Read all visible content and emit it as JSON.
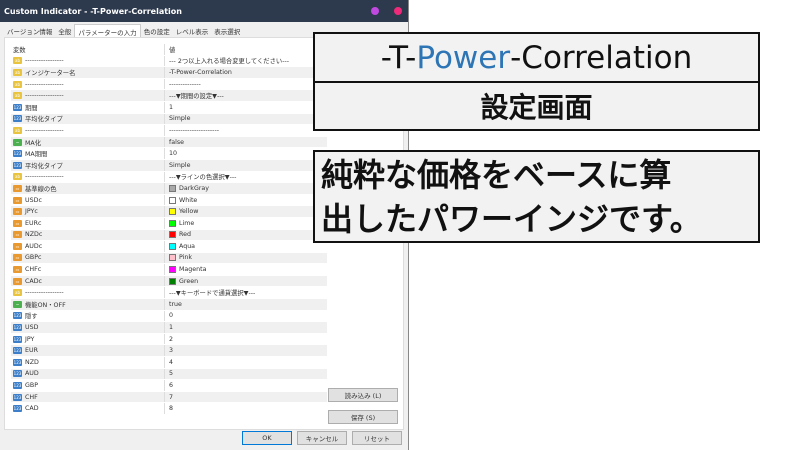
{
  "window": {
    "title": "Custom Indicator - -T-Power-Correlation",
    "dot_colors": [
      "#c04ae0",
      "#f02a7a"
    ]
  },
  "tabs": [
    {
      "label": "バージョン情報"
    },
    {
      "label": "全般"
    },
    {
      "label": "パラメーターの入力",
      "active": true
    },
    {
      "label": "色の設定"
    },
    {
      "label": "レベル表示"
    },
    {
      "label": "表示選択"
    }
  ],
  "grid": {
    "headers": [
      "変数",
      "値"
    ],
    "rows": [
      {
        "type": "s",
        "name": "-----------------",
        "value": "--- 2つ以上入れる場合変更してください---"
      },
      {
        "type": "s",
        "name": "インジケーター名",
        "value": "-T-Power-Correlation"
      },
      {
        "type": "s",
        "name": "-----------------",
        "value": "--------------"
      },
      {
        "type": "s",
        "name": "-----------------",
        "value": "---▼期間の設定▼---"
      },
      {
        "type": "i",
        "name": "期間",
        "value": "1"
      },
      {
        "type": "i",
        "name": "平均化タイプ",
        "value": "Simple"
      },
      {
        "type": "s",
        "name": "-----------------",
        "value": "----------------------"
      },
      {
        "type": "b",
        "name": "MA化",
        "value": "false"
      },
      {
        "type": "i",
        "name": "MA期間",
        "value": "10"
      },
      {
        "type": "i",
        "name": "平均化タイプ",
        "value": "Simple"
      },
      {
        "type": "s",
        "name": "-----------------",
        "value": "---▼ラインの色選択▼---"
      },
      {
        "type": "c",
        "name": "基準線の色",
        "value": "DarkGray",
        "color": "#a9a9a9"
      },
      {
        "type": "c",
        "name": "USDc",
        "value": "White",
        "color": "#ffffff"
      },
      {
        "type": "c",
        "name": "JPYc",
        "value": "Yellow",
        "color": "#ffff00"
      },
      {
        "type": "c",
        "name": "EURc",
        "value": "Lime",
        "color": "#00ff00"
      },
      {
        "type": "c",
        "name": "NZDc",
        "value": "Red",
        "color": "#ff0000"
      },
      {
        "type": "c",
        "name": "AUDc",
        "value": "Aqua",
        "color": "#00ffff"
      },
      {
        "type": "c",
        "name": "GBPc",
        "value": "Pink",
        "color": "#ffc0cb"
      },
      {
        "type": "c",
        "name": "CHFc",
        "value": "Magenta",
        "color": "#ff00ff"
      },
      {
        "type": "c",
        "name": "CADc",
        "value": "Green",
        "color": "#008000"
      },
      {
        "type": "s",
        "name": "-----------------",
        "value": "---▼キーボードで通貨選択▼---"
      },
      {
        "type": "b",
        "name": "機能ON・OFF",
        "value": "true"
      },
      {
        "type": "i",
        "name": "隠す",
        "value": "0"
      },
      {
        "type": "i",
        "name": "USD",
        "value": "1"
      },
      {
        "type": "i",
        "name": "JPY",
        "value": "2"
      },
      {
        "type": "i",
        "name": "EUR",
        "value": "3"
      },
      {
        "type": "i",
        "name": "NZD",
        "value": "4"
      },
      {
        "type": "i",
        "name": "AUD",
        "value": "5"
      },
      {
        "type": "i",
        "name": "GBP",
        "value": "6"
      },
      {
        "type": "i",
        "name": "CHF",
        "value": "7"
      },
      {
        "type": "i",
        "name": "CAD",
        "value": "8"
      }
    ]
  },
  "icon_labels": {
    "s": "ab",
    "i": "123",
    "b": "~",
    "c": "▭"
  },
  "buttons": {
    "load": "読み込み (L)",
    "save": "保存 (S)",
    "ok": "OK",
    "cancel": "キャンセル",
    "reset": "リセット"
  },
  "overlay": {
    "title_pre": "-T-",
    "title_accent": "Power",
    "title_post": "-Correlation",
    "accent_color": "#2e75b6",
    "subtitle": "設定画面",
    "description_line1": "純粋な価格をベースに算",
    "description_line2": "出したパワーインジです。"
  }
}
